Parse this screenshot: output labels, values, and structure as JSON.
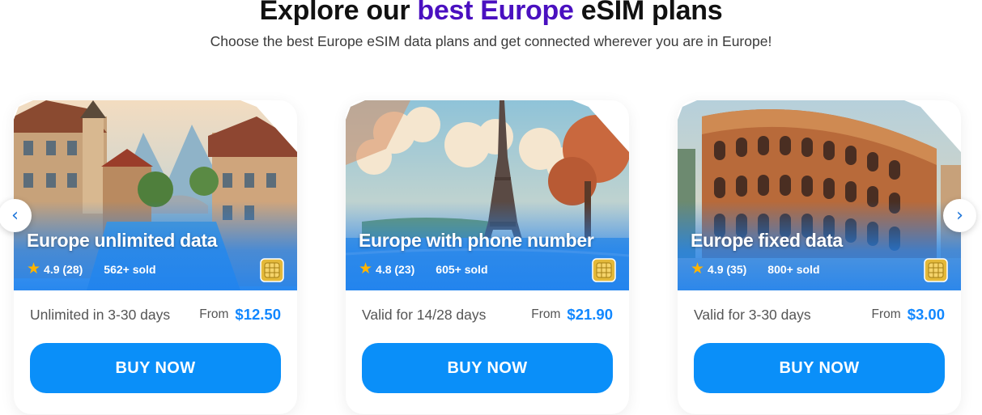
{
  "heading": {
    "prefix": "Explore our ",
    "highlight": "best Europe",
    "suffix": " eSIM plans",
    "subtitle": "Choose the best Europe eSIM data plans and get connected wherever you are in Europe!"
  },
  "colors": {
    "heading_highlight": "#4a10c0",
    "price": "#1187ff",
    "button": "#0a8ff9",
    "star": "#ffb400",
    "overlay": "#1e82f0"
  },
  "navigation": {
    "prev_icon": "‹",
    "next_icon": "›"
  },
  "plans": [
    {
      "title": "Europe unlimited data",
      "rating": "4.9 (28)",
      "sold": "562+ sold",
      "validity": "Unlimited in 3-30 days",
      "from_label": "From",
      "price": "$12.50",
      "button": "BUY NOW",
      "image": "european-village-canal"
    },
    {
      "title": "Europe with phone number",
      "rating": "4.8 (23)",
      "sold": "605+ sold",
      "validity": "Valid for 14/28 days",
      "from_label": "From",
      "price": "$21.90",
      "button": "BUY NOW",
      "image": "eiffel-tower"
    },
    {
      "title": "Europe fixed data",
      "rating": "4.9 (35)",
      "sold": "800+ sold",
      "validity": "Valid for 3-30 days",
      "from_label": "From",
      "price": "$3.00",
      "button": "BUY NOW",
      "image": "colosseum"
    }
  ]
}
